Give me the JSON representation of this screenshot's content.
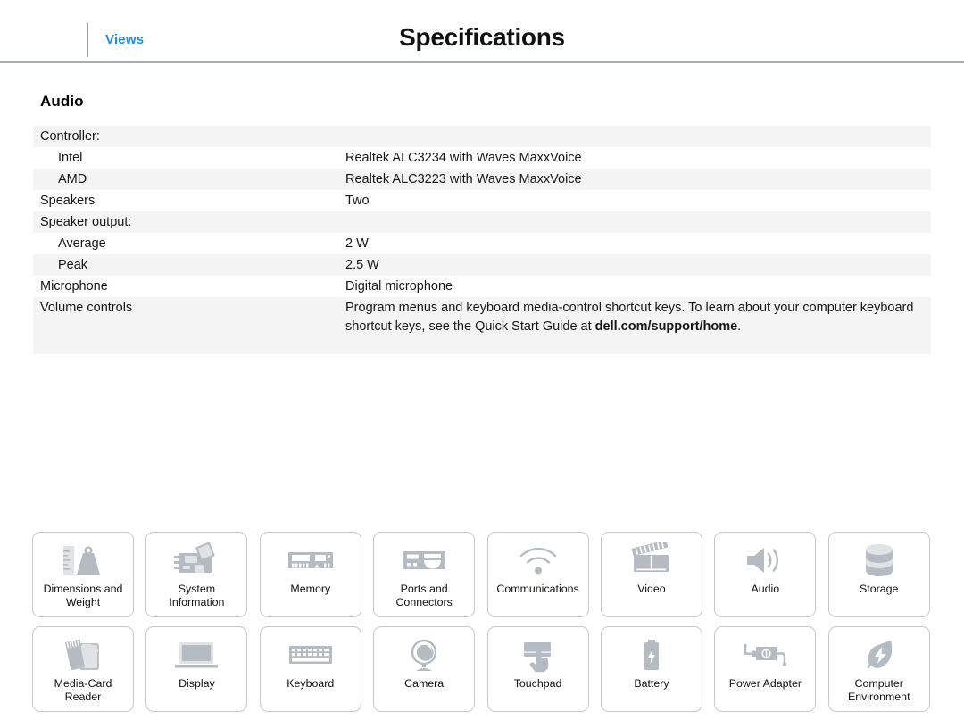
{
  "header": {
    "views_label": "Views",
    "title": "Specifications",
    "rule_color": "#a7abb1",
    "link_color": "#1f8ddb"
  },
  "section": {
    "heading": "Audio"
  },
  "spec_table": {
    "rows": [
      {
        "label": "Controller:",
        "value": "",
        "indent": false,
        "shaded": true
      },
      {
        "label": "Intel",
        "value": "Realtek ALC3234 with Waves MaxxVoice",
        "indent": true,
        "shaded": false
      },
      {
        "label": "AMD",
        "value": "Realtek ALC3223 with Waves MaxxVoice",
        "indent": true,
        "shaded": true
      },
      {
        "label": "Speakers",
        "value": "Two",
        "indent": false,
        "shaded": false
      },
      {
        "label": "Speaker output:",
        "value": "",
        "indent": false,
        "shaded": true
      },
      {
        "label": "Average",
        "value": "2 W",
        "indent": true,
        "shaded": false
      },
      {
        "label": "Peak",
        "value": "2.5 W",
        "indent": true,
        "shaded": true
      },
      {
        "label": "Microphone",
        "value": "Digital microphone",
        "indent": false,
        "shaded": false
      }
    ],
    "volume_row": {
      "label": "Volume controls",
      "value_part1": "Program menus and keyboard media-control shortcut keys. To learn about your computer keyboard shortcut keys, see the Quick Start Guide at ",
      "value_link": "dell.com/support/home",
      "value_part2": ".",
      "shaded": true
    }
  },
  "icon_grid": {
    "tiles": [
      {
        "label": "Dimensions and\nWeight",
        "icon": "ruler-and-weight-icon"
      },
      {
        "label": "System\nInformation",
        "icon": "circuit-board-icon"
      },
      {
        "label": "Memory",
        "icon": "memory-module-icon"
      },
      {
        "label": "Ports and\nConnectors",
        "icon": "ports-connectors-icon"
      },
      {
        "label": "Communications",
        "icon": "wifi-icon"
      },
      {
        "label": "Video",
        "icon": "clapperboard-icon"
      },
      {
        "label": "Audio",
        "icon": "speaker-volume-icon"
      },
      {
        "label": "Storage",
        "icon": "hard-drive-cylinder-icon"
      },
      {
        "label": "Media-Card\nReader",
        "icon": "media-card-icon"
      },
      {
        "label": "Display",
        "icon": "laptop-display-icon"
      },
      {
        "label": "Keyboard",
        "icon": "keyboard-icon"
      },
      {
        "label": "Camera",
        "icon": "webcam-icon"
      },
      {
        "label": "Touchpad",
        "icon": "touchpad-hand-icon"
      },
      {
        "label": "Battery",
        "icon": "battery-icon"
      },
      {
        "label": "Power Adapter",
        "icon": "power-adapter-icon"
      },
      {
        "label": "Computer\nEnvironment",
        "icon": "leaf-bolt-icon"
      }
    ]
  },
  "colors": {
    "row_shade": "#f4f4f4",
    "icon_fill": "#b4bbc2",
    "tile_border": "#c6c9cd"
  }
}
